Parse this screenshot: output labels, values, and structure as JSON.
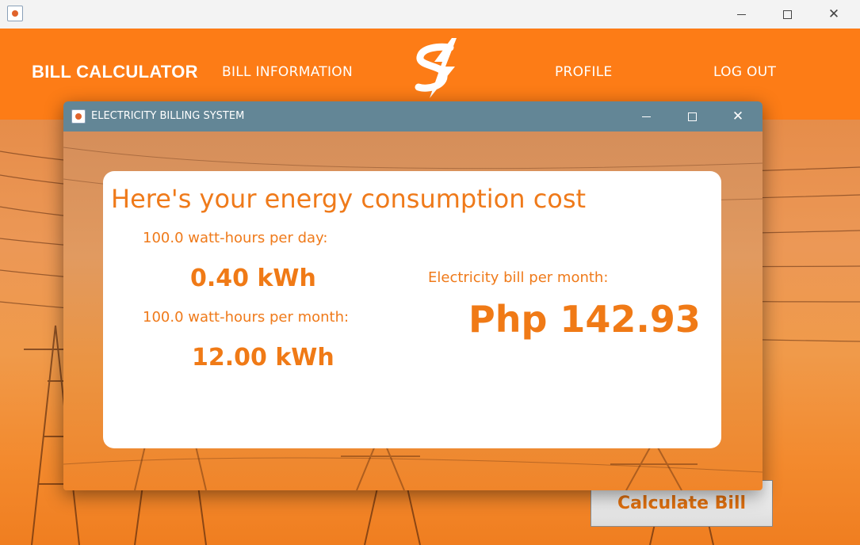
{
  "main_window": {
    "nav": {
      "title": "BILL CALCULATOR",
      "bill_information": "BILL INFORMATION",
      "profile": "PROFILE",
      "logout": "LOG OUT"
    },
    "calculate_button": "Calculate Bill"
  },
  "dialog": {
    "title": "ELECTRICITY BILLING SYSTEM",
    "heading": "Here's your energy consumption cost",
    "per_day_label": "100.0 watt-hours per day:",
    "per_day_value": "0.40 kWh",
    "per_month_label": "100.0 watt-hours per month:",
    "per_month_value": "12.00 kWh",
    "bill_label": "Electricity bill per month:",
    "bill_value": "Php 142.93"
  },
  "colors": {
    "accent": "#fd7c16",
    "dialog_titlebar": "#638696",
    "text_orange": "#ef7a1a"
  },
  "icons": {
    "app": "java-app-icon",
    "logo": "lightning-peso-logo-icon"
  }
}
